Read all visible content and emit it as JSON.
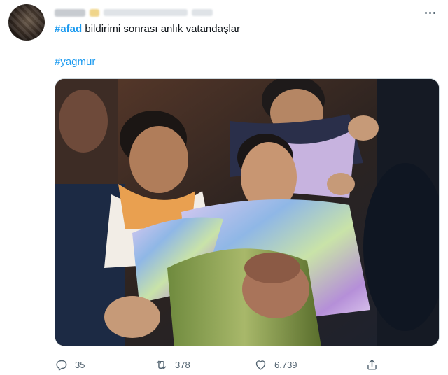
{
  "tweet": {
    "hashtag1": "#afad",
    "text": " bildirimi sonrası anlık vatandaşlar",
    "hashtag2": "#yagmur"
  },
  "actions": {
    "replies": "35",
    "retweets": "378",
    "likes": "6.739"
  },
  "icons": {
    "more": "more-horizontal-icon",
    "reply": "reply-icon",
    "retweet": "retweet-icon",
    "like": "heart-icon",
    "share": "share-icon"
  },
  "colors": {
    "accent": "#1d9bf0",
    "secondary_text": "#536471"
  }
}
